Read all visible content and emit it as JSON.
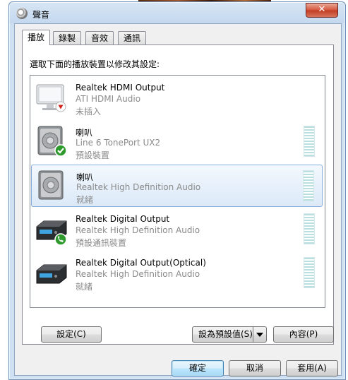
{
  "window": {
    "title": "聲音",
    "close_label": "✕"
  },
  "tabs": [
    {
      "label": "播放",
      "active": true
    },
    {
      "label": "錄製",
      "active": false
    },
    {
      "label": "音效",
      "active": false
    },
    {
      "label": "通訊",
      "active": false
    }
  ],
  "instruction": "選取下面的播放裝置以修改其設定:",
  "devices": [
    {
      "name": "Realtek HDMI Output",
      "description": "ATI HDMI Audio",
      "status": "未插入",
      "icon": "hdmi-monitor-icon",
      "badge": "unplugged-red-arrow"
    },
    {
      "name": "喇叭",
      "description": "Line 6 TonePort UX2",
      "status": "預設裝置",
      "icon": "speaker-icon",
      "badge": "default-green-check"
    },
    {
      "name": "喇叭",
      "description": "Realtek High Definition Audio",
      "status": "就緒",
      "icon": "speaker-icon",
      "selected": true
    },
    {
      "name": "Realtek Digital Output",
      "description": "Realtek High Definition Audio",
      "status": "預設通訊裝置",
      "icon": "digital-receiver-icon",
      "badge": "communication-phone-icon"
    },
    {
      "name": "Realtek Digital Output(Optical)",
      "description": "Realtek High Definition Audio",
      "status": "就緒",
      "icon": "digital-receiver-icon"
    }
  ],
  "panel_buttons": {
    "configure": "設定(C)",
    "set_default": "設為預設值(S)",
    "properties": "內容(P)"
  },
  "dialog_buttons": {
    "ok": "確定",
    "cancel": "取消",
    "apply": "套用(A)"
  },
  "colors": {
    "selection_border": "#84acdd",
    "meter": "#b9dfe0",
    "window_frame": "#c4d8ee"
  }
}
